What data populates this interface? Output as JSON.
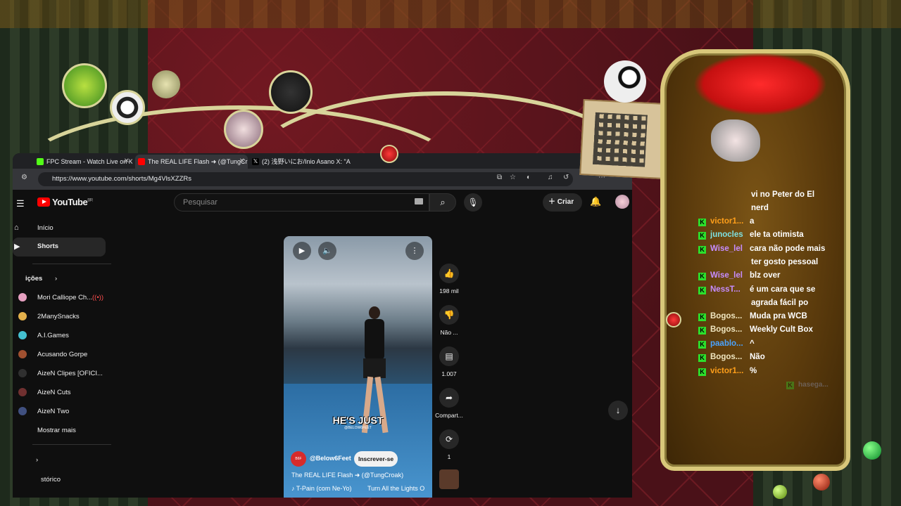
{
  "browser": {
    "tabs": [
      {
        "title": "FPC Stream - Watch Live on K"
      },
      {
        "title": "The REAL LIFE Flash ➜ (@TungCr"
      },
      {
        "title": "(2) 浅野いにお/Inio Asano X: \"A"
      }
    ],
    "url": "https://www.youtube.com/shorts/Mg4VlsXZZRs"
  },
  "youtube": {
    "logo": "YouTube",
    "region": "BR",
    "search_placeholder": "Pesquisar",
    "create_label": "Criar",
    "nav": [
      {
        "label": "Início",
        "icon": "home-icon"
      },
      {
        "label": "Shorts",
        "icon": "shorts-icon"
      }
    ],
    "subscriptions_label": "Inscrições",
    "subscriptions_visible": "ições",
    "subscriptions": [
      {
        "name": "Mori Calliope Ch...",
        "color": "#e6a0c0"
      },
      {
        "name": "2ManySnacks",
        "color": "#e3b04b"
      },
      {
        "name": "A.I.Games",
        "color": "#44c0d0"
      },
      {
        "name": "Acusando Gorpe",
        "color": "#a05030"
      },
      {
        "name": "AizeN Clipes [OFICI...",
        "color": "#303030"
      },
      {
        "name": "AizeN Cuts",
        "color": "#703030"
      },
      {
        "name": "AizeN Two",
        "color": "#405080"
      }
    ],
    "show_more": "Mostrar mais",
    "history_visible": "stórico",
    "video": {
      "caption": "HE'S JUST",
      "watermark": "@BELOW6FEET",
      "channel": "@Below6Feet",
      "subscribe": "Inscrever-se",
      "title": "The REAL LIFE Flash ➜ (@TungCroak)",
      "song_artist": "T-Pain (com Ne-Yo)",
      "song_title": "Turn All the Lights O",
      "progress_percent": 18
    },
    "actions": {
      "likes": "198 mil",
      "dislike": "Não ...",
      "comments": "1.007",
      "share": "Compart...",
      "remix": "1"
    }
  },
  "chat": {
    "top_lines": [
      "vi no Peter do El",
      "nerd"
    ],
    "messages": [
      {
        "user": "victor1...",
        "text": "a",
        "color": "#ff9f1a"
      },
      {
        "user": "junocles",
        "text": "ele ta otimista",
        "color": "#7ee0e0"
      },
      {
        "user": "Wise_lel",
        "text": "cara não pode mais",
        "cont": "ter gosto pessoal",
        "color": "#c68cff"
      },
      {
        "user": "Wise_lel",
        "text": "blz over",
        "color": "#c68cff"
      },
      {
        "user": "NessT...",
        "text": "é um cara que se",
        "cont": "agrada fácil po",
        "color": "#c68cff"
      },
      {
        "user": "Bogos...",
        "text": "Muda pra WCB",
        "color": "#f0e6c0"
      },
      {
        "user": "Bogos...",
        "text": "Weekly Cult Box",
        "color": "#f0e6c0"
      },
      {
        "user": "paablo...",
        "text": "^",
        "color": "#4aa3ff"
      },
      {
        "user": "Bogos...",
        "text": "Não",
        "color": "#f0e6c0"
      },
      {
        "user": "victor1...",
        "text": "%",
        "color": "#ff9f1a"
      }
    ],
    "faded_user": "hasega..."
  }
}
